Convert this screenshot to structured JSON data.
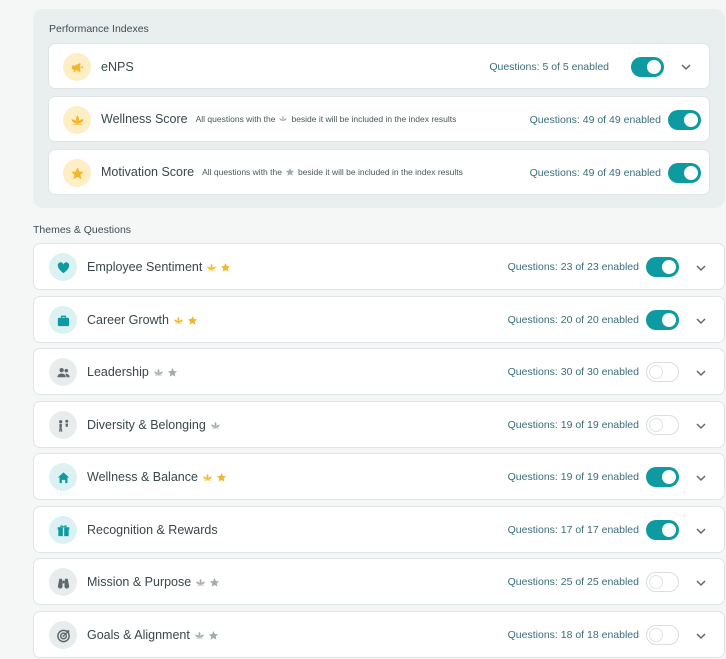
{
  "performance": {
    "title": "Performance Indexes",
    "items": [
      {
        "label": "eNPS",
        "note": "",
        "count": "Questions: 5 of 5 enabled",
        "enabled": true,
        "icon": "megaphone-icon"
      },
      {
        "label": "Wellness Score",
        "note_pre": "All questions with the",
        "note_post": "beside it will be included in the index results",
        "note_icon": "lotus-icon",
        "count": "Questions: 49 of 49 enabled",
        "enabled": true,
        "icon": "lotus-icon"
      },
      {
        "label": "Motivation Score",
        "note_pre": "All questions with the",
        "note_post": "beside it will be included in the index results",
        "note_icon": "star-icon",
        "count": "Questions: 49 of 49 enabled",
        "enabled": true,
        "icon": "star-icon"
      }
    ]
  },
  "themes": {
    "title": "Themes & Questions",
    "items": [
      {
        "label": "Employee Sentiment",
        "count": "Questions: 23 of 23 enabled",
        "enabled": true,
        "icon": "heart-icon",
        "badges_active": true
      },
      {
        "label": "Career Growth",
        "count": "Questions: 20 of 20 enabled",
        "enabled": true,
        "icon": "briefcase-icon",
        "badges_active": true
      },
      {
        "label": "Leadership",
        "count": "Questions: 30 of 30 enabled",
        "enabled": false,
        "icon": "people-icon",
        "badges_active": false
      },
      {
        "label": "Diversity & Belonging",
        "count": "Questions: 19 of 19 enabled",
        "enabled": false,
        "icon": "diversity-icon",
        "badges_active": false,
        "lotus_only": true
      },
      {
        "label": "Wellness & Balance",
        "count": "Questions: 19 of 19 enabled",
        "enabled": true,
        "icon": "home-icon",
        "badges_active": true
      },
      {
        "label": "Recognition & Rewards",
        "count": "Questions: 17 of 17 enabled",
        "enabled": true,
        "icon": "gift-icon",
        "badges_active": null
      },
      {
        "label": "Mission & Purpose",
        "count": "Questions: 25 of 25 enabled",
        "enabled": false,
        "icon": "binoculars-icon",
        "badges_active": false
      },
      {
        "label": "Goals & Alignment",
        "count": "Questions: 18 of 18 enabled",
        "enabled": false,
        "icon": "target-icon",
        "badges_active": false
      }
    ]
  },
  "colors": {
    "accent": "#0d9aa0",
    "gold": "#f2b72c",
    "grey_badge": "#a4acaf"
  }
}
